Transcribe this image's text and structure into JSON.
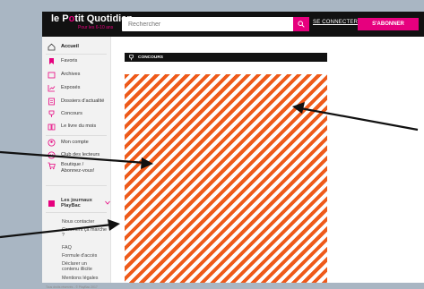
{
  "header": {
    "logo_part1": "le P",
    "logo_o": "o",
    "logo_part2": "tit Quotidien",
    "tagline": "Pour les 6-10 ans",
    "search_placeholder": "Rechercher",
    "connect_label": "SE CONNECTER",
    "subscribe_label": "S'ABONNER"
  },
  "sidebar": {
    "items": [
      {
        "label": "Accueil",
        "icon": "home-icon"
      },
      {
        "label": "Favoris",
        "icon": "bookmark-icon"
      },
      {
        "label": "Archives",
        "icon": "folder-icon"
      },
      {
        "label": "Exposés",
        "icon": "chart-icon"
      },
      {
        "label": "Dossiers d'actualité",
        "icon": "document-icon"
      },
      {
        "label": "Concours",
        "icon": "trophy-icon"
      },
      {
        "label": "Le livre du mois",
        "icon": "book-icon"
      },
      {
        "label": "Mon compte",
        "icon": "user-icon"
      },
      {
        "label": "Club des lecteurs",
        "icon": "club-icon"
      },
      {
        "label": "Boutique / Abonnez-vous!",
        "icon": "cart-icon"
      },
      {
        "label": "Les journaux PlayBac",
        "icon": "newspaper-icon"
      }
    ],
    "links": [
      "Nous contacter",
      "Comment ça marche ?",
      "FAQ",
      "Formule d'accès",
      "Déclarer un contenu illicite",
      "Mentions légales"
    ],
    "copyright": "Tous droits réservés - © PlayBac 2017"
  },
  "main": {
    "contest_title": "CONCOURS"
  },
  "colors": {
    "brand": "#e6007e",
    "pattern_orange": "#ee5a1a",
    "header_bg": "#111111"
  }
}
